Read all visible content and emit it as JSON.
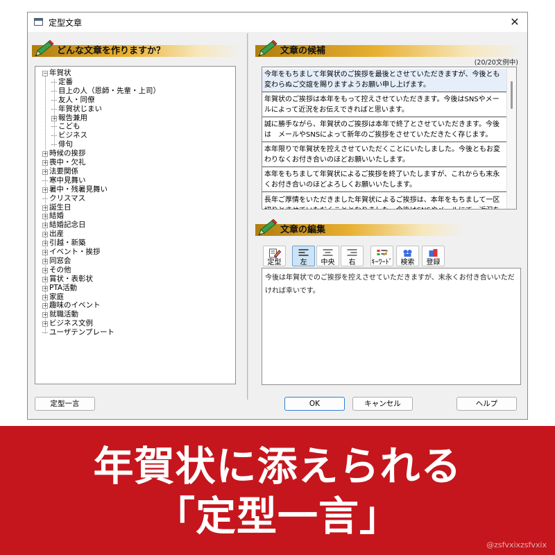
{
  "window": {
    "title": "定型文章",
    "close_glyph": "✕"
  },
  "left_pane": {
    "header": "どんな文章を作りますか？",
    "tree": [
      {
        "label": "年賀状",
        "level": 0,
        "expander": "−"
      },
      {
        "label": "定番",
        "level": 1,
        "expander": ""
      },
      {
        "label": "目上の人（恩師・先輩・上司）",
        "level": 1,
        "expander": ""
      },
      {
        "label": "友人・同僚",
        "level": 1,
        "expander": ""
      },
      {
        "label": "年賀状じまい",
        "level": 1,
        "expander": ""
      },
      {
        "label": "報告兼用",
        "level": 1,
        "expander": "+"
      },
      {
        "label": "こども",
        "level": 1,
        "expander": ""
      },
      {
        "label": "ビジネス",
        "level": 1,
        "expander": ""
      },
      {
        "label": "俳句",
        "level": 1,
        "expander": ""
      },
      {
        "label": "時候の挨拶",
        "level": 0,
        "expander": "+"
      },
      {
        "label": "喪中・欠礼",
        "level": 0,
        "expander": "+"
      },
      {
        "label": "法要関係",
        "level": 0,
        "expander": "+"
      },
      {
        "label": "寒中見舞い",
        "level": 0,
        "expander": ""
      },
      {
        "label": "暑中・残暑見舞い",
        "level": 0,
        "expander": "+"
      },
      {
        "label": "クリスマス",
        "level": 0,
        "expander": ""
      },
      {
        "label": "誕生日",
        "level": 0,
        "expander": "+"
      },
      {
        "label": "結婚",
        "level": 0,
        "expander": "+"
      },
      {
        "label": "結婚記念日",
        "level": 0,
        "expander": "+"
      },
      {
        "label": "出産",
        "level": 0,
        "expander": "+"
      },
      {
        "label": "引越・新築",
        "level": 0,
        "expander": "+"
      },
      {
        "label": "イベント・挨拶",
        "level": 0,
        "expander": "+"
      },
      {
        "label": "同窓会",
        "level": 0,
        "expander": "+"
      },
      {
        "label": "その他",
        "level": 0,
        "expander": "+"
      },
      {
        "label": "賞状・表彰状",
        "level": 0,
        "expander": "+"
      },
      {
        "label": "PTA活動",
        "level": 0,
        "expander": "+"
      },
      {
        "label": "家庭",
        "level": 0,
        "expander": "+"
      },
      {
        "label": "趣味のイベント",
        "level": 0,
        "expander": "+"
      },
      {
        "label": "就職活動",
        "level": 0,
        "expander": "+"
      },
      {
        "label": "ビジネス文例",
        "level": 0,
        "expander": "+"
      },
      {
        "label": "ユーザテンプレート",
        "level": 0,
        "expander": ""
      }
    ],
    "phrase_button": "定型一言"
  },
  "candidates": {
    "header": "文章の候補",
    "count": "(20/20文例中)",
    "items": [
      "今年をもちまして年賀状のご挨拶を最後とさせていただきますが、今後とも変わらぬご交誼を賜りますようお願い申し上げます。",
      "年賀状のご挨拶は本年をもって控えさせていただきます。今後はSNSやメールによって近況をお伝えできればと思います。",
      "誠に勝手ながら、年賀状のご挨拶は本年で終了とさせていただきます。今後は　メールやSNSによって新年のご挨拶をさせていただきたく存じます。",
      "本年限りで年賀状を控えさせていただくことにいたしました。今後ともお変わりなくお付き合いのほどお願いいたします。",
      "本年をもちまして年賀状によるご挨拶を終了いたしますが、これからも末永くお付き合いのほどよろしくお願いいたします。",
      "長年ご厚情をいただきました年賀状によるご挨拶は、本年をもちまして一区切りとさせていただくこととなりました。今後はSNSやメールにて、近況をお伝え"
    ]
  },
  "editor": {
    "header": "文章の編集",
    "toolbar": {
      "template": "定型",
      "left": "左",
      "center": "中央",
      "right": "右",
      "keyword": "ｷｰﾜｰﾄﾞ",
      "search": "検索",
      "register": "登録"
    },
    "text": "今後は年賀状でのご挨拶を控えさせていただきますが、末永くお付き合いいただければ幸いです。"
  },
  "buttons": {
    "ok": "OK",
    "cancel": "キャンセル",
    "help": "ヘルプ"
  },
  "banner": {
    "line1": "年賀状に添えられる",
    "line2": "「定型一言」",
    "watermark": "@zsfvxixzsfvxix"
  },
  "colors": {
    "banner_red": "#c5161d",
    "header_gold": "#e8b030",
    "accent_blue": "#2f7fd0"
  }
}
